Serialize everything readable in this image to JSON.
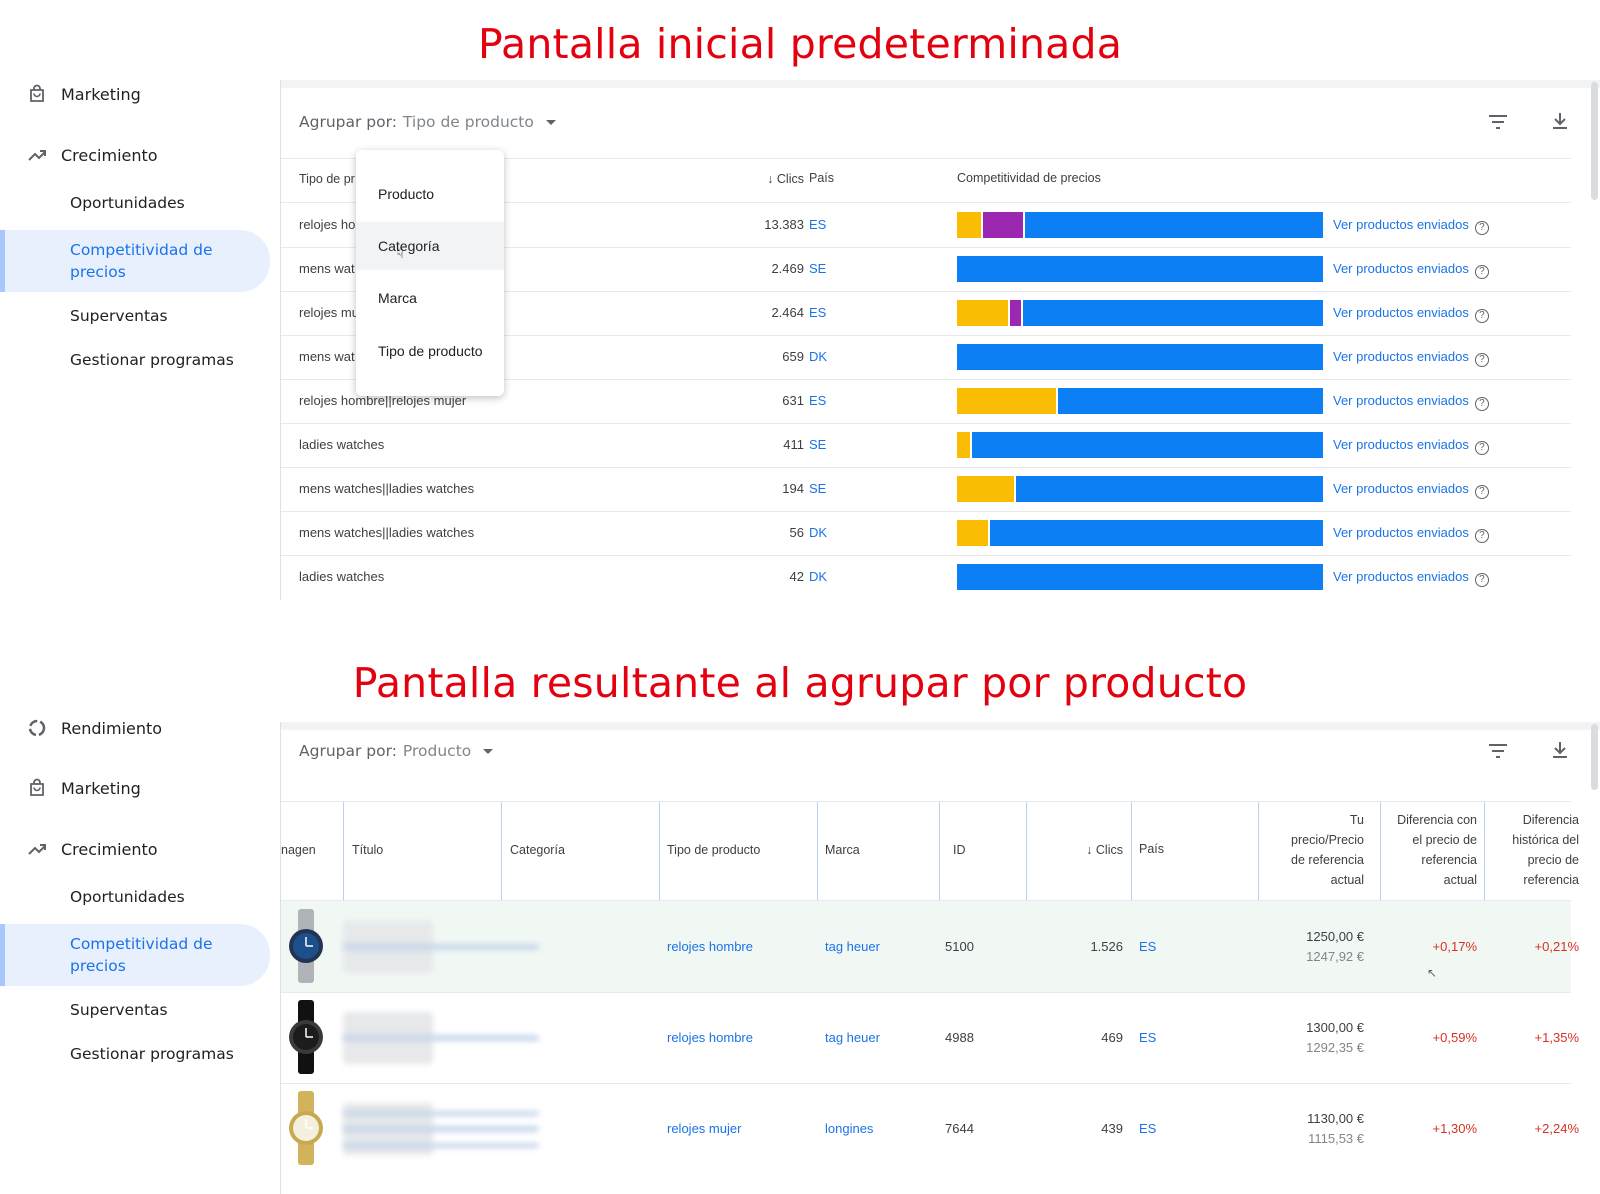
{
  "headings": {
    "top": "Pantalla inicial predeterminada",
    "bottom": "Pantalla resultante al agrupar por producto"
  },
  "colors": {
    "heading": "#e3000f",
    "accent": "#1a73e8",
    "bar_yellow": "#fbbc04",
    "bar_purple": "#9c27b0",
    "bar_blue": "#0d7ff4",
    "negative": "#d93025"
  },
  "top": {
    "sidebar": {
      "marketing": "Marketing",
      "crecimiento": "Crecimiento",
      "items": [
        "Oportunidades",
        "Competitividad de precios",
        "Superventas",
        "Gestionar programas"
      ]
    },
    "group_by_label": "Agrupar por:",
    "group_by_value": "Tipo de producto",
    "columns": {
      "tipo": "Tipo de pr",
      "clics": "Clics",
      "pais": "País",
      "competitividad": "Competitividad de precios"
    },
    "dropdown": [
      "Producto",
      "Categoría",
      "Marca",
      "Tipo de producto"
    ],
    "link_label": "Ver productos enviados",
    "rows": [
      {
        "tipo": "relojes ho",
        "clics": "13.383",
        "pais": "ES",
        "bar": [
          0.065,
          0.115,
          0.82
        ]
      },
      {
        "tipo": "mens wat",
        "clics": "2.469",
        "pais": "SE",
        "bar": [
          0,
          0,
          1
        ]
      },
      {
        "tipo": "relojes mu",
        "clics": "2.464",
        "pais": "ES",
        "bar": [
          0.14,
          0.035,
          0.825
        ]
      },
      {
        "tipo": "mens wat",
        "clics": "659",
        "pais": "DK",
        "bar": [
          0,
          0,
          1
        ]
      },
      {
        "tipo": "relojes hombre||relojes mujer",
        "clics": "631",
        "pais": "ES",
        "bar": [
          0.27,
          0,
          0.73
        ]
      },
      {
        "tipo": "ladies watches",
        "clics": "411",
        "pais": "SE",
        "bar": [
          0.035,
          0,
          0.965
        ]
      },
      {
        "tipo": "mens watches||ladies watches",
        "clics": "194",
        "pais": "SE",
        "bar": [
          0.155,
          0,
          0.845
        ]
      },
      {
        "tipo": "mens watches||ladies watches",
        "clics": "56",
        "pais": "DK",
        "bar": [
          0.085,
          0,
          0.915
        ]
      },
      {
        "tipo": "ladies watches",
        "clics": "42",
        "pais": "DK",
        "bar": [
          0,
          0,
          1
        ]
      }
    ]
  },
  "bottom": {
    "sidebar": {
      "rendimiento": "Rendimiento",
      "marketing": "Marketing",
      "crecimiento": "Crecimiento",
      "items": [
        "Oportunidades",
        "Competitividad de precios",
        "Superventas",
        "Gestionar programas"
      ]
    },
    "group_by_label": "Agrupar por:",
    "group_by_value": "Producto",
    "columns": {
      "imagen": "nagen",
      "titulo": "Título",
      "categoria": "Categoría",
      "tipo": "Tipo de producto",
      "marca": "Marca",
      "id": "ID",
      "clics": "Clics",
      "pais": "País",
      "precio": [
        "Tu",
        "precio/Precio",
        "de referencia",
        "actual"
      ],
      "diferencia": [
        "Diferencia con",
        "el precio de",
        "referencia",
        "actual"
      ],
      "historica": [
        "Diferencia",
        "histórica del",
        "precio de",
        "referencia"
      ]
    },
    "rows": [
      {
        "tipo": "relojes hombre",
        "marca": "tag heuer",
        "id": "5100",
        "clics": "1.526",
        "pais": "ES",
        "precio": "1250,00 €",
        "ref": "1247,92 €",
        "dif": "+0,17%",
        "hist": "+0,21%"
      },
      {
        "tipo": "relojes hombre",
        "marca": "tag heuer",
        "id": "4988",
        "clics": "469",
        "pais": "ES",
        "precio": "1300,00 €",
        "ref": "1292,35 €",
        "dif": "+0,59%",
        "hist": "+1,35%"
      },
      {
        "tipo": "relojes mujer",
        "marca": "longines",
        "id": "7644",
        "clics": "439",
        "pais": "ES",
        "precio": "1130,00 €",
        "ref": "1115,53 €",
        "dif": "+1,30%",
        "hist": "+2,24%"
      }
    ]
  }
}
